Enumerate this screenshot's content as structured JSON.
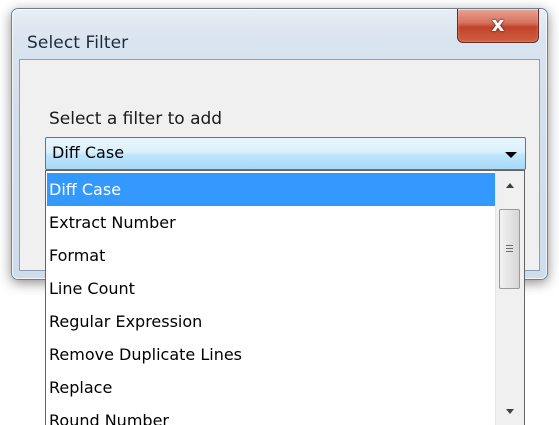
{
  "window": {
    "title": "Select Filter",
    "close_glyph": "x"
  },
  "form": {
    "prompt": "Select a filter to add"
  },
  "combo": {
    "selected": "Diff Case"
  },
  "dropdown": {
    "items": [
      "Diff Case",
      "Extract Number",
      "Format",
      "Line Count",
      "Regular Expression",
      "Remove Duplicate Lines",
      "Replace",
      "Round Number"
    ],
    "highlighted_index": 0
  },
  "colors": {
    "highlight": "#3399ff",
    "close_button": "#c8503a",
    "combo_border": "#3c7fb1"
  }
}
